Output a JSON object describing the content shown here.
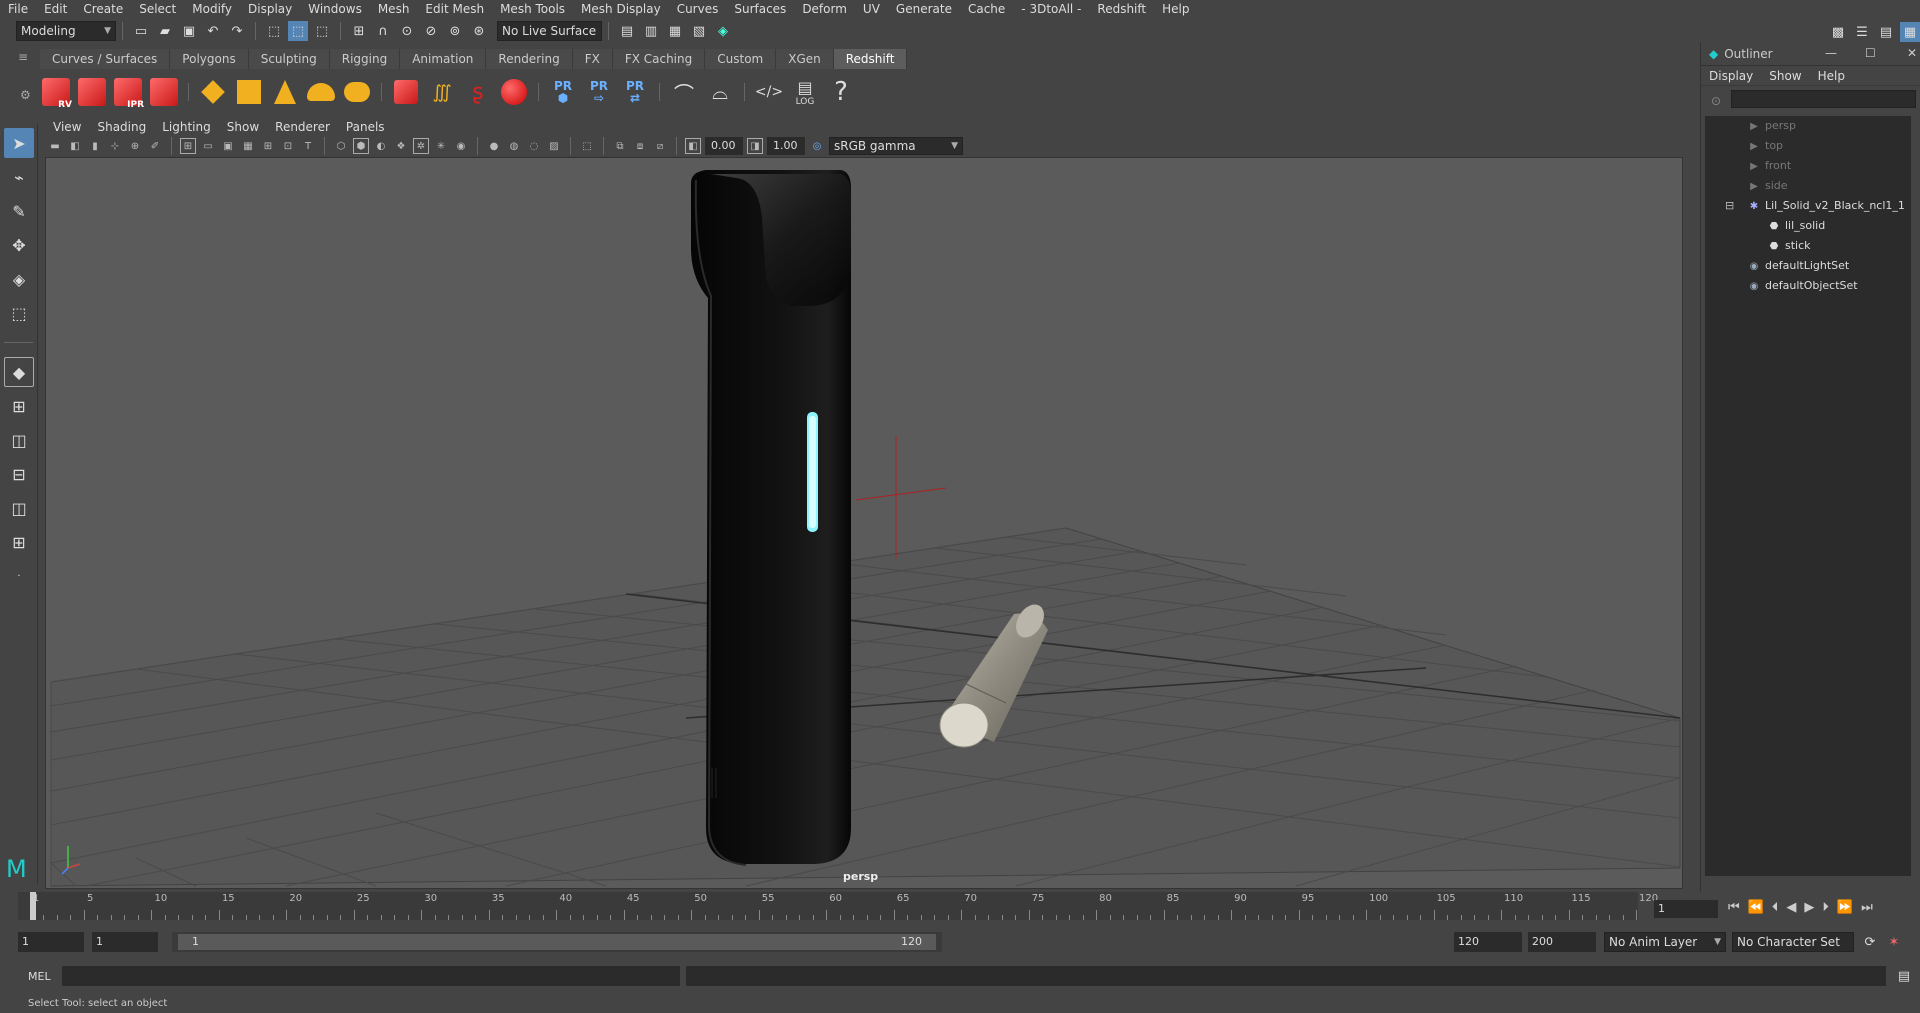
{
  "menubar": {
    "items": [
      "File",
      "Edit",
      "Create",
      "Select",
      "Modify",
      "Display",
      "Windows",
      "Mesh",
      "Edit Mesh",
      "Mesh Tools",
      "Mesh Display",
      "Curves",
      "Surfaces",
      "Deform",
      "UV",
      "Generate",
      "Cache",
      "- 3DtoAll -",
      "Redshift",
      "Help"
    ]
  },
  "statusline": {
    "mode": "Modeling",
    "live_surface": "No Live Surface"
  },
  "shelf": {
    "tabs": [
      "Curves / Surfaces",
      "Polygons",
      "Sculpting",
      "Rigging",
      "Animation",
      "Rendering",
      "FX",
      "FX Caching",
      "Custom",
      "XGen",
      "Redshift"
    ],
    "active_tab": "Redshift",
    "rv_label": "RV",
    "ipr_label": "IPR",
    "pr_label": "PR",
    "log_label": "LOG"
  },
  "viewport": {
    "menu": [
      "View",
      "Shading",
      "Lighting",
      "Show",
      "Renderer",
      "Panels"
    ],
    "exposure": "0.00",
    "gamma": "1.00",
    "color_space": "sRGB gamma",
    "camera_label": "persp"
  },
  "outliner": {
    "title": "Outliner",
    "menu": [
      "Display",
      "Show",
      "Help"
    ],
    "items": [
      {
        "label": "persp",
        "dim": true,
        "icon": "camera-icon"
      },
      {
        "label": "top",
        "dim": true,
        "icon": "camera-icon"
      },
      {
        "label": "front",
        "dim": true,
        "icon": "camera-icon"
      },
      {
        "label": "side",
        "dim": true,
        "icon": "camera-icon"
      },
      {
        "label": "Lil_Solid_v2_Black_ncl1_1",
        "dim": false,
        "icon": "group-icon"
      },
      {
        "label": "lil_solid",
        "dim": false,
        "icon": "mesh-icon"
      },
      {
        "label": "stick",
        "dim": false,
        "icon": "mesh-icon"
      },
      {
        "label": "defaultLightSet",
        "dim": false,
        "icon": "set-icon"
      },
      {
        "label": "defaultObjectSet",
        "dim": false,
        "icon": "set-icon"
      }
    ]
  },
  "timeline": {
    "ticks": [
      "1",
      "5",
      "10",
      "15",
      "20",
      "25",
      "30",
      "35",
      "40",
      "45",
      "50",
      "55",
      "60",
      "65",
      "70",
      "75",
      "80",
      "85",
      "90",
      "95",
      "100",
      "105",
      "110",
      "115",
      "120"
    ],
    "current_frame": "1"
  },
  "range": {
    "start": "1",
    "playback_start": "1",
    "slider_start": "1",
    "slider_end": "120",
    "playback_end": "120",
    "end": "200",
    "anim_layer": "No Anim Layer",
    "character_set": "No Character Set"
  },
  "cmdline": {
    "label": "MEL"
  },
  "helpline": {
    "text": "Select Tool: select an object"
  }
}
